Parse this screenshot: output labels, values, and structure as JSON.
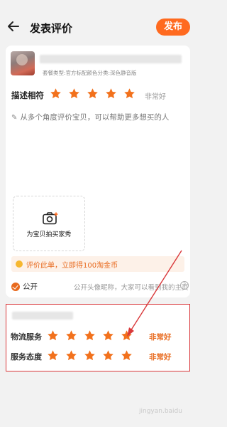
{
  "header": {
    "title": "发表评价",
    "publish_label": "发布"
  },
  "product": {
    "spec": "套餐类型:官方标配颜色分类:深色静音版"
  },
  "description_rating": {
    "label": "描述相符",
    "stars": 5,
    "text": "非常好"
  },
  "review": {
    "placeholder": "从多个角度评价宝贝，可以帮助更多想买的人"
  },
  "photo": {
    "label": "为宝贝拍买家秀"
  },
  "coin_banner": {
    "text": "评价此单，立即得100淘金币"
  },
  "visibility": {
    "label": "公开",
    "note": "公开头像昵称，大家可以看到我的主页"
  },
  "shop_ratings": [
    {
      "label": "物流服务",
      "stars": 5,
      "text": "非常好"
    },
    {
      "label": "服务态度",
      "stars": 5,
      "text": "非常好"
    }
  ],
  "colors": {
    "accent": "#ff6a1f",
    "star": "#f2711c",
    "highlight_border": "#d9383a"
  },
  "watermark": "jingyan.baidu"
}
